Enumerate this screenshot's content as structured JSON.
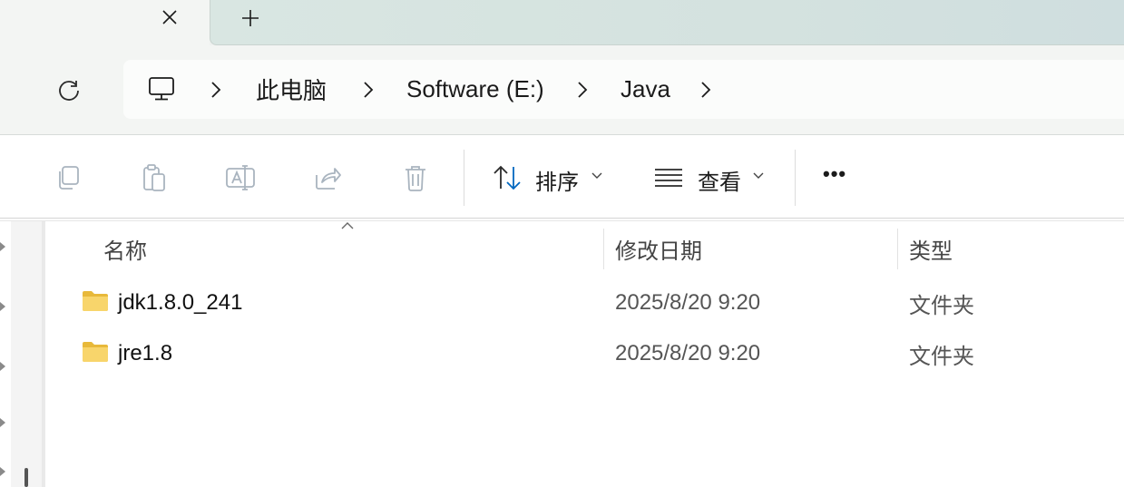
{
  "tabs": {
    "close_icon": "close-icon",
    "new_tab_icon": "plus-icon"
  },
  "nav": {
    "refresh_icon": "refresh-icon"
  },
  "breadcrumb": {
    "root_icon": "this-pc-icon",
    "items": [
      "此电脑",
      "Software (E:)",
      "Java"
    ]
  },
  "toolbar": {
    "copy_icon": "copy-icon",
    "paste_icon": "paste-icon",
    "rename_icon": "rename-icon",
    "share_icon": "share-icon",
    "delete_icon": "delete-icon",
    "sort_label": "排序",
    "view_label": "查看",
    "more_label": "•••"
  },
  "columns": {
    "name": "名称",
    "modified": "修改日期",
    "type": "类型"
  },
  "files": [
    {
      "name": "jdk1.8.0_241",
      "modified": "2025/8/20 9:20",
      "type": "文件夹"
    },
    {
      "name": "jre1.8",
      "modified": "2025/8/20 9:20",
      "type": "文件夹"
    }
  ],
  "colors": {
    "accent": "#0067c0",
    "folder": "#f2c94c",
    "disabled_icon": "#a9b4bf"
  }
}
